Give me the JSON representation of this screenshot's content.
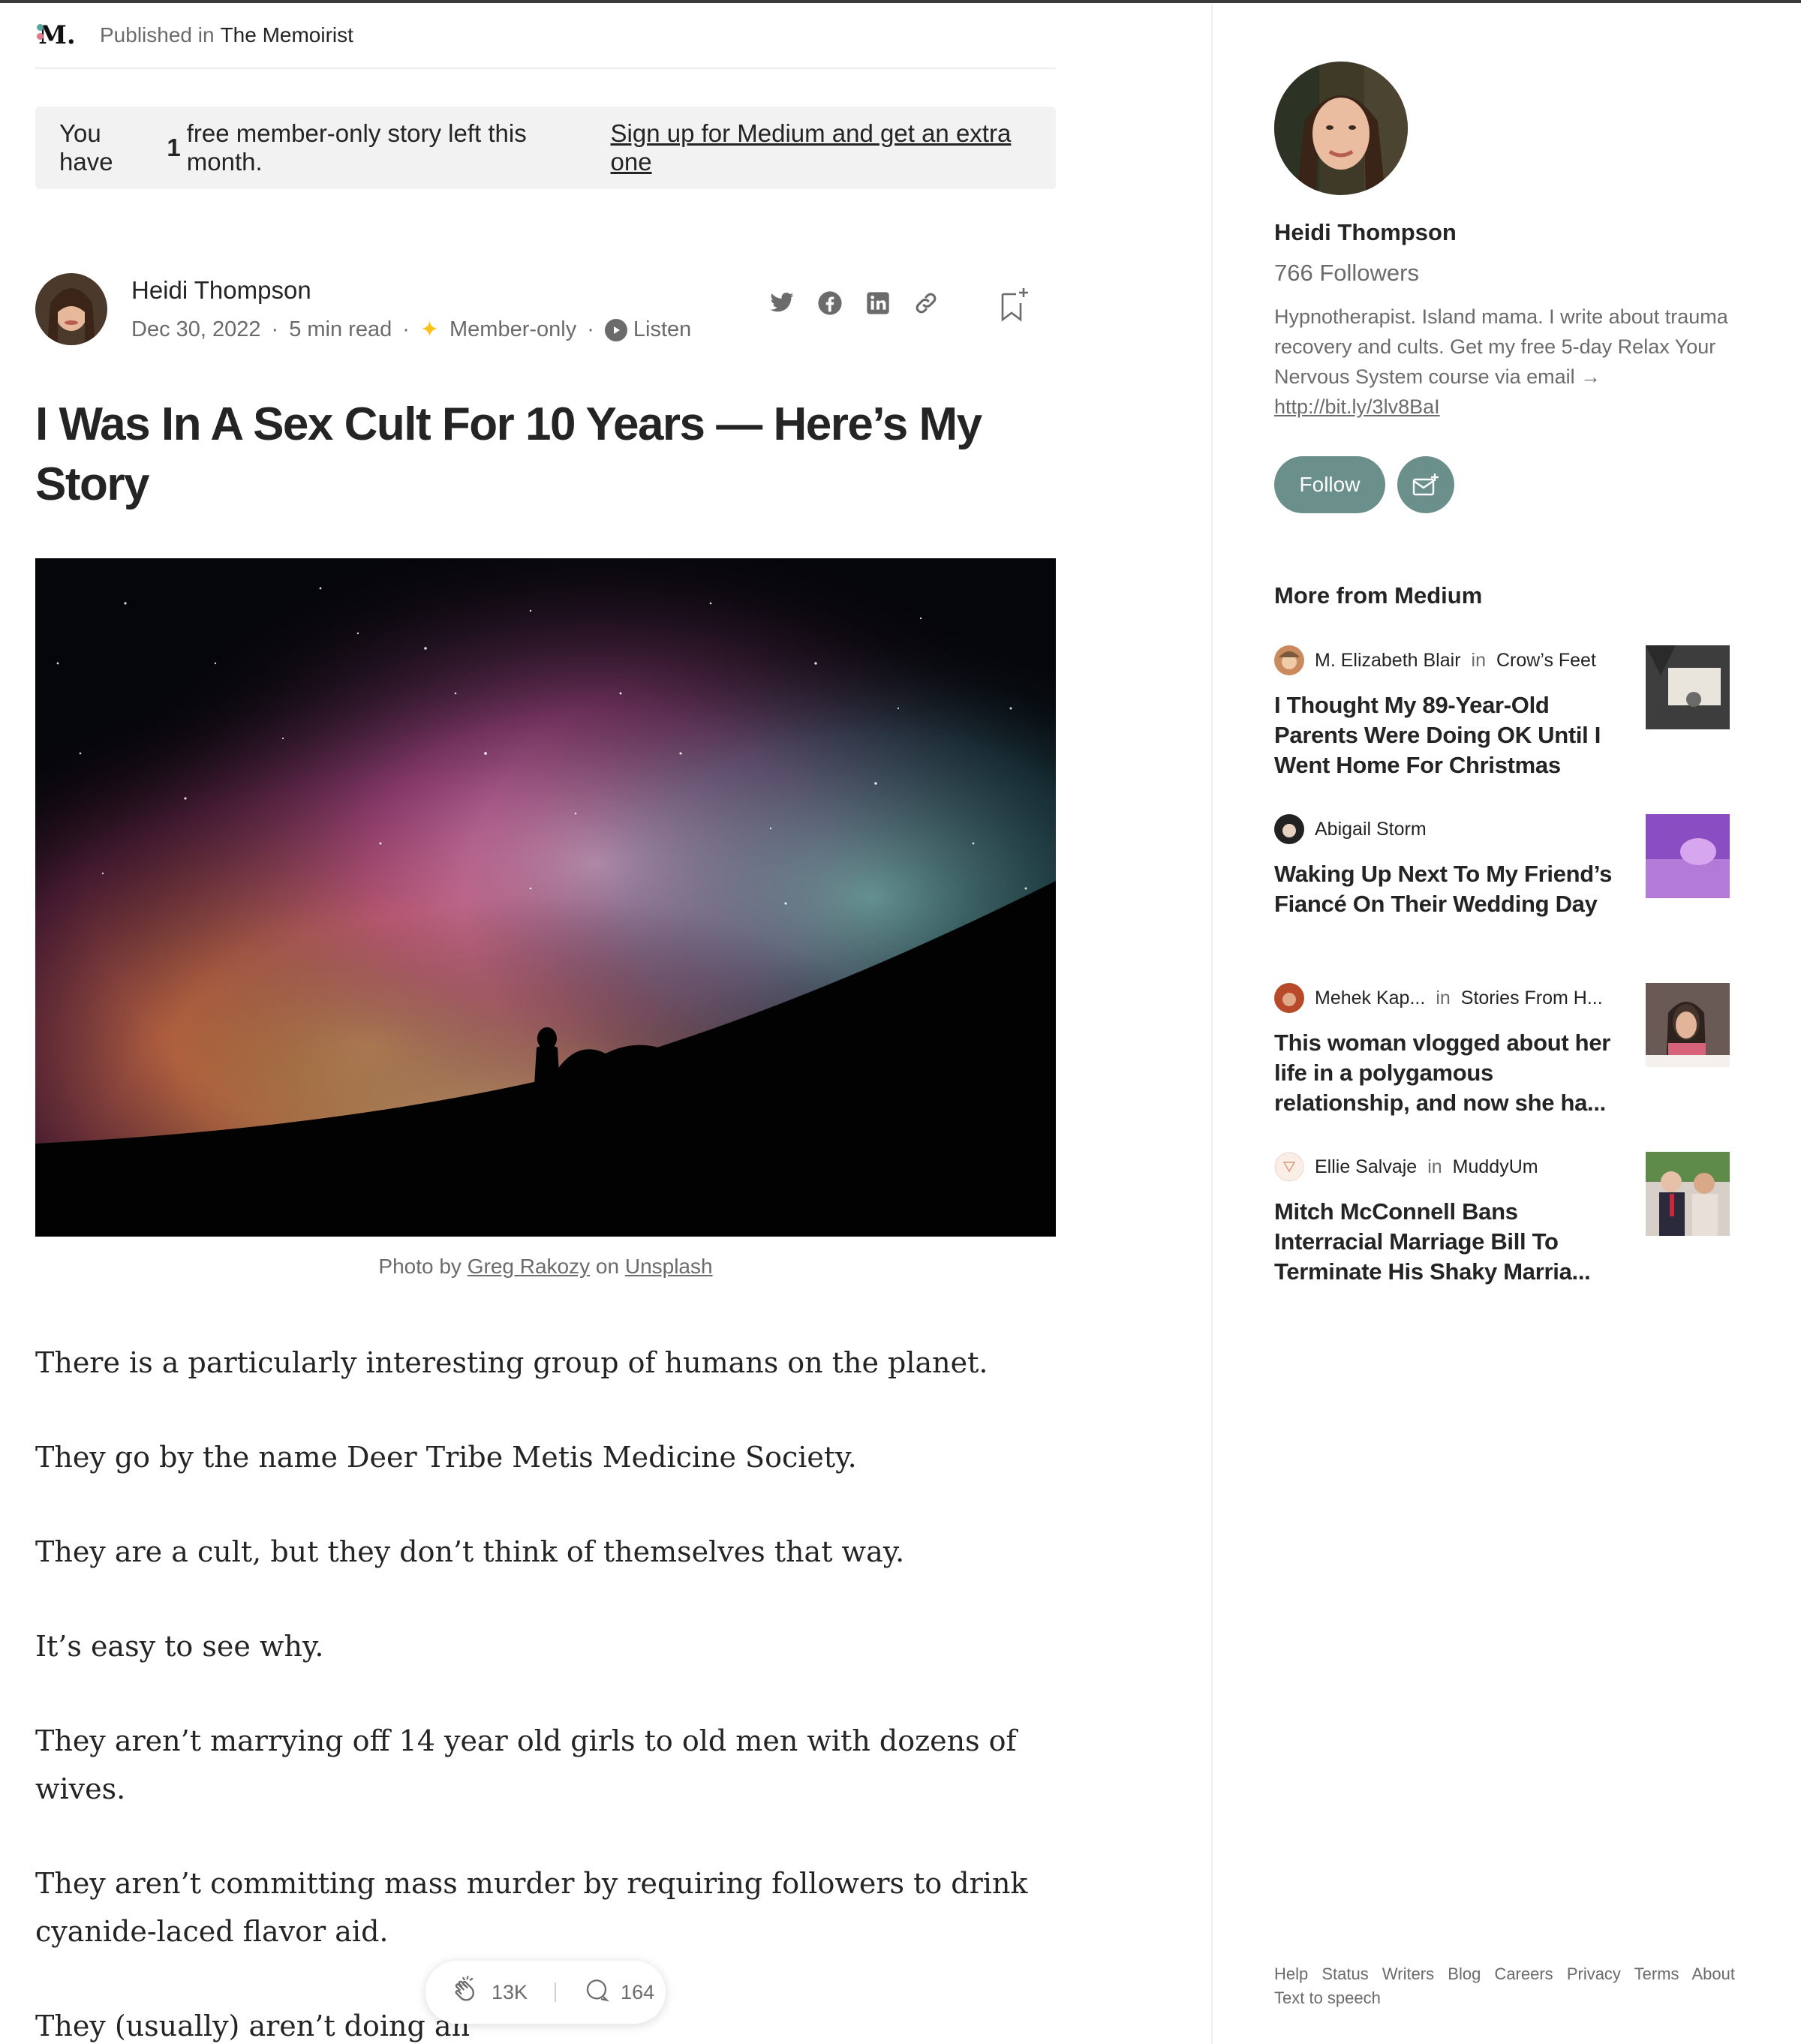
{
  "publication": {
    "published_in_label": "Published in",
    "name": "The Memoirist",
    "logo_text": "M."
  },
  "banner": {
    "prefix": "You have",
    "count": "1",
    "middle": "free member-only story left this month.",
    "link": "Sign up for Medium and get an extra one"
  },
  "article": {
    "author": "Heidi Thompson",
    "date": "Dec 30, 2022",
    "read_time": "5 min read",
    "member_only": "Member-only",
    "listen": "Listen",
    "title": "I Was In A Sex Cult For 10 Years — Here’s My Story",
    "caption_prefix": "Photo by",
    "caption_author": "Greg Rakozy",
    "caption_on": "on",
    "caption_source": "Unsplash",
    "paragraphs": [
      "There is a particularly interesting group of humans on the planet.",
      "They go by the name Deer Tribe Metis Medicine Society.",
      "They are a cult, but they don’t think of themselves that way.",
      "It’s easy to see why.",
      "They aren’t marrying off 14 year old girls to old men with dozens of wives.",
      "They aren’t committing mass murder by requiring followers to drink cyanide-laced flavor aid.",
      "They (usually) aren’t doing an"
    ],
    "claps": "13K",
    "responses": "164"
  },
  "share_icons": [
    "twitter-icon",
    "facebook-icon",
    "linkedin-icon",
    "link-icon"
  ],
  "sidebar": {
    "author_name": "Heidi Thompson",
    "followers": "766 Followers",
    "bio": "Hypnotherapist. Island mama. I write about trauma recovery and cults. Get my free 5-day Relax Your Nervous System course via email →",
    "bio_link": "http://bit.ly/3lv8BaI",
    "follow_label": "Follow",
    "more_title": "More from Medium",
    "recommendations": [
      {
        "author": "M. Elizabeth Blair",
        "in_label": "in",
        "publication": "Crow’s Feet",
        "title": "I Thought My 89-Year-Old Parents Were Doing OK Until I Went Home For Christmas"
      },
      {
        "author": "Abigail Storm",
        "in_label": "",
        "publication": "",
        "title": "Waking Up Next To My Friend’s Fiancé On Their Wedding Day"
      },
      {
        "author": "Mehek Kap...",
        "in_label": "in",
        "publication": "Stories From H...",
        "title": "This woman vlogged about her life in a polygamous relationship, and now she ha..."
      },
      {
        "author": "Ellie Salvaje",
        "in_label": "in",
        "publication": "MuddyUm",
        "title": "Mitch McConnell Bans Interracial Marriage Bill To Terminate His Shaky Marria..."
      }
    ]
  },
  "footer": {
    "links": [
      "Help",
      "Status",
      "Writers",
      "Blog",
      "Careers",
      "Privacy",
      "Terms",
      "About"
    ],
    "text_to_speech": "Text to speech"
  },
  "colors": {
    "accent_follow": "#6b8f8a",
    "member_star": "#ffc017",
    "text_primary": "#242424",
    "text_secondary": "#6b6b6b"
  }
}
